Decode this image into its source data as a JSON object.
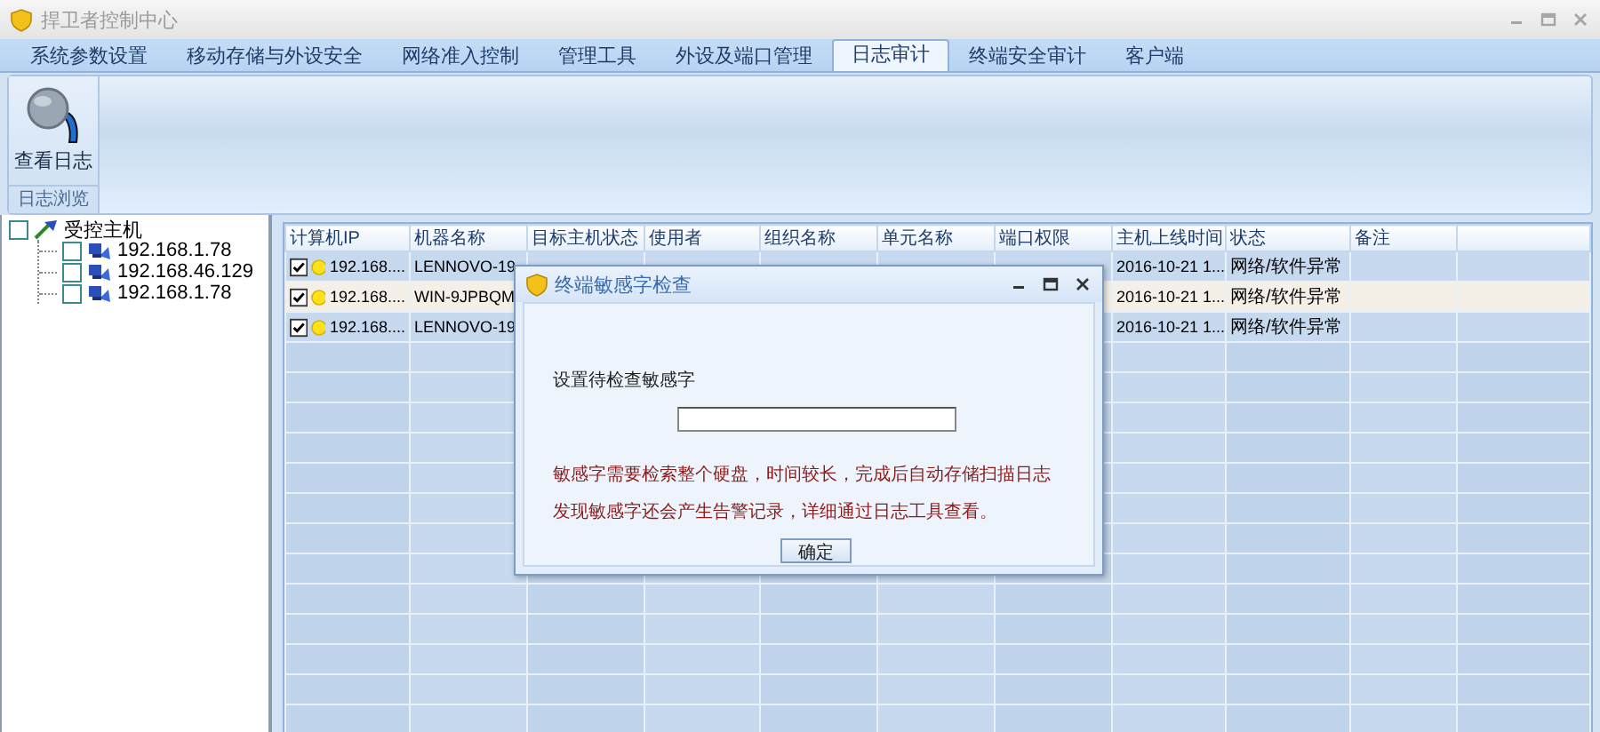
{
  "window": {
    "title": "捍卫者控制中心",
    "active": false
  },
  "tabs": [
    {
      "label": "系统参数设置",
      "selected": false
    },
    {
      "label": "移动存储与外设安全",
      "selected": false
    },
    {
      "label": "网络准入控制",
      "selected": false
    },
    {
      "label": "管理工具",
      "selected": false
    },
    {
      "label": "外设及端口管理",
      "selected": false
    },
    {
      "label": "日志审计",
      "selected": true
    },
    {
      "label": "终端安全审计",
      "selected": false
    },
    {
      "label": "客户端",
      "selected": false
    }
  ],
  "ribbon": {
    "buttons": [
      {
        "label": "查看日志"
      }
    ],
    "group_label": "日志浏览"
  },
  "tree": {
    "label": "受控主机",
    "checked": false,
    "children": [
      {
        "label": "192.168.1.78",
        "checked": false
      },
      {
        "label": "192.168.46.129",
        "checked": false
      },
      {
        "label": "192.168.1.78",
        "checked": false
      }
    ]
  },
  "table": {
    "columns": [
      "计算机IP",
      "机器名称",
      "目标主机状态",
      "使用者",
      "组织名称",
      "单元名称",
      "端口权限",
      "主机上线时间",
      "状态",
      "备注"
    ],
    "rows": [
      {
        "checked": true,
        "selected": false,
        "ip": "192.168....",
        "machine_name": "LENNOVO-19",
        "online_time": "2016-10-21 1...",
        "status": "网络/软件异常"
      },
      {
        "checked": true,
        "selected": true,
        "ip": "192.168....",
        "machine_name": "WIN-9JPBQM",
        "online_time": "2016-10-21 1...",
        "status": "网络/软件异常"
      },
      {
        "checked": true,
        "selected": false,
        "ip": "192.168....",
        "machine_name": "LENNOVO-19",
        "online_time": "2016-10-21 1...",
        "status": "网络/软件异常"
      }
    ]
  },
  "dialog": {
    "title": "终端敏感字检查",
    "field_label": "设置待检查敏感字",
    "messages": [
      "敏感字需要检索整个硬盘，时间较长，完成后自动存储扫描日志",
      "发现敏感字还会产生告警记录，详细通过日志工具查看。"
    ],
    "button": "确定"
  }
}
